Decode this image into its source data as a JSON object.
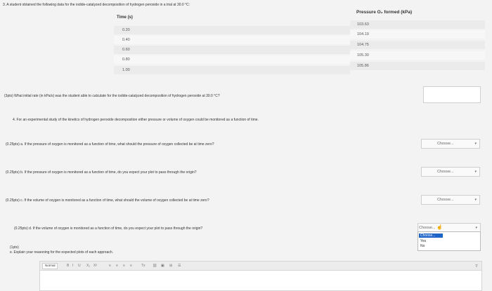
{
  "question3": {
    "intro": "3. A student obtained the following data for the iodide-catalyzed decomposition of hydrogen peroxide in a trial at 30.0 °C:",
    "table": {
      "col1_header": "Time (s)",
      "col2_header": "Pressure O₂ formed (kPa)",
      "rows": [
        {
          "time": "0.20",
          "pressure": "103.63"
        },
        {
          "time": "0.40",
          "pressure": "104.19"
        },
        {
          "time": "0.60",
          "pressure": "104.75"
        },
        {
          "time": "0.80",
          "pressure": "105.30"
        },
        {
          "time": "1.00",
          "pressure": "105.86"
        }
      ]
    },
    "initial_rate_prompt": "(3pts) What initial rate (in kPa/s) was the student able to calculate for the iodide-catalyzed decomposition of hydrogen peroxide at 30.0 °C?",
    "answer_value": ""
  },
  "question4": {
    "intro": "4. For an experimental study of the kinetics of hydrogen peroxide decomposition either pressure or volume of oxygen could be monitored as a function of time.",
    "parts": [
      {
        "text": "(0.25pts)  a. If the pressure of oxygen is monitored as a function of time, what should the pressure of oxygen collected be at time zero?",
        "select": "Choose..."
      },
      {
        "text": "(0.25pts)  b. If the pressure of oxygen is monitored as a function of time, do you expect your plot to pass through the origin?",
        "select": "Choose..."
      },
      {
        "text": "(0.25pts)  c. If the volume of oxygen is monitored as a function of time, what should the volume of oxygen collected be at time zero?",
        "select": "Choose..."
      },
      {
        "text": "(0.25pts)  d. If the volume of oxygen is monitored as a function of time, do you expect your plot to pass through the origin?",
        "select": "Choose..."
      }
    ],
    "dropdown_options": [
      "Choose...",
      "Yes",
      "No"
    ],
    "explain_points": "(1pts)",
    "explain_prompt": "e. Explain your reasoning for the expected plots of each approach.",
    "editor": {
      "format": "Normal",
      "buttons": [
        "B",
        "I",
        "U",
        "X₂",
        "X²",
        "≡",
        "≡",
        "≡",
        "≡",
        "Tx"
      ]
    }
  }
}
